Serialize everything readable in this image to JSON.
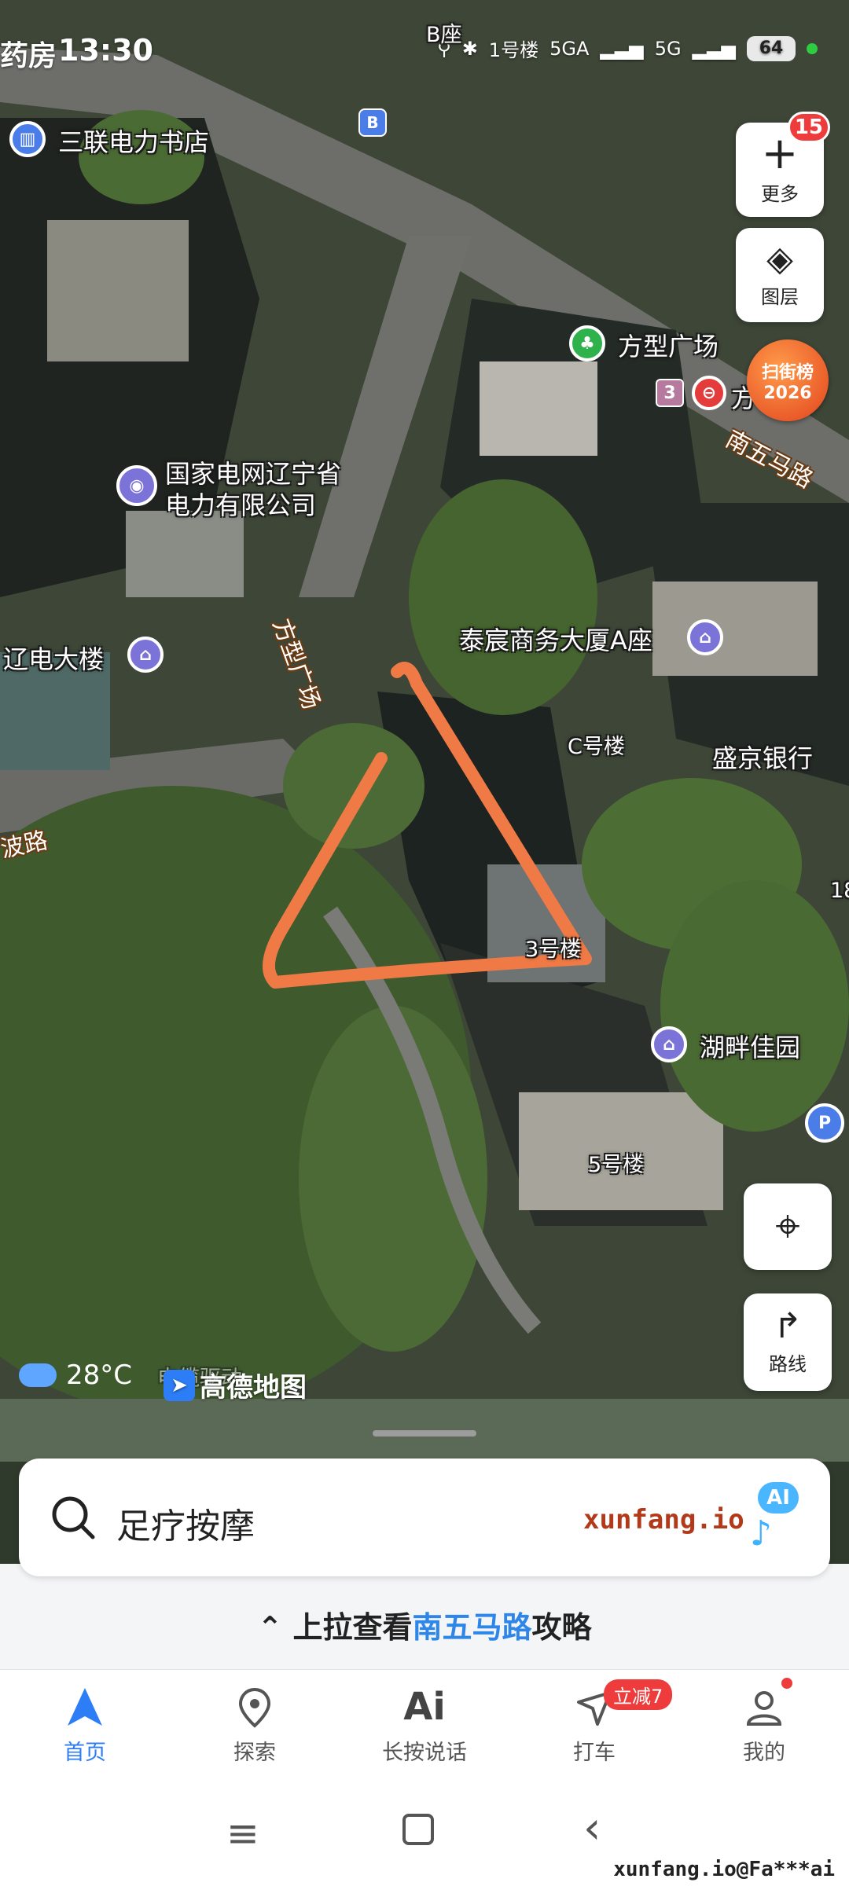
{
  "status_bar": {
    "left_cut_text": "药房",
    "time": "13:30",
    "cut_label": "1号楼",
    "network": "5GA",
    "network2": "5G",
    "battery": "64"
  },
  "map": {
    "labels": {
      "b_zuo": "B座",
      "bookstore": "三联电力书店",
      "fangxing_square": "方型广场",
      "fangxing_cut": "方",
      "state_grid": "国家电网辽宁省",
      "state_grid_2": "电力有限公司",
      "road_nanwuma": "南五马路",
      "road_fangxing": "方型广场",
      "liaodian": "辽电大楼",
      "taichen": "泰宸商务大厦A座",
      "c_building": "C号楼",
      "shengjing_bank": "盛京银行",
      "road_bo": "波路",
      "building_3": "3号楼",
      "hupan": "湖畔佳园",
      "building_5": "5号楼",
      "edge_18": "18",
      "bottom_cut": "电缆驱动"
    },
    "metro_line": "3",
    "bus_icon": "B",
    "annotation_color": "#f07a45"
  },
  "float_buttons": {
    "more_label": "更多",
    "more_badge": "15",
    "layers_label": "图层",
    "route_label": "路线",
    "sjb_line1": "扫街榜",
    "sjb_line2": "2026"
  },
  "weather": {
    "temp": "28°C"
  },
  "logo": {
    "text": "高德地图"
  },
  "search": {
    "placeholder": "足疗按摩",
    "watermark": "xunfang.io",
    "ai_badge": "AI"
  },
  "pullup": {
    "prefix": "上拉查看",
    "highlight": "南五马路",
    "suffix": "攻略"
  },
  "tabs": [
    {
      "label": "首页",
      "icon": "home-nav-icon"
    },
    {
      "label": "探索",
      "icon": "location-pin-icon"
    },
    {
      "label": "长按说话",
      "icon": "ai-voice-icon"
    },
    {
      "label": "打车",
      "icon": "taxi-icon",
      "badge": "立减7"
    },
    {
      "label": "我的",
      "icon": "user-icon"
    }
  ],
  "footer_watermark": "xunfang.io@Fa***ai",
  "colors": {
    "accent": "#2d7df6",
    "badge_red": "#ee3b3b",
    "highlight": "#2d86e8"
  }
}
